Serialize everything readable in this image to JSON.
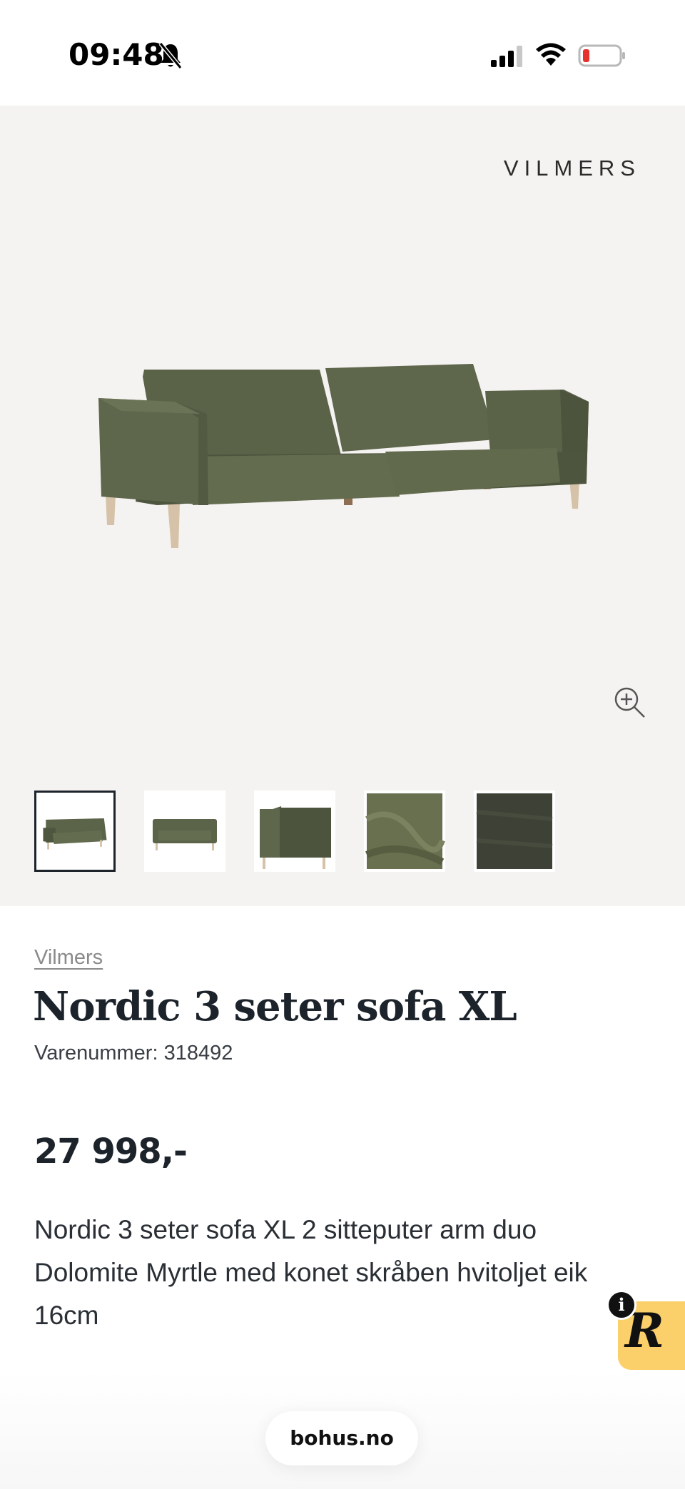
{
  "status_bar": {
    "time": "09:48",
    "icons": [
      "bell-slash-icon",
      "signal-icon",
      "wifi-icon",
      "battery-low-icon"
    ],
    "battery_color": "#e5322d"
  },
  "gallery": {
    "brand_logo": "VILMERS",
    "main_image": "sofa-image",
    "zoom_icon": "zoom-in-icon",
    "thumbnails": [
      {
        "name": "thumb-sofa-front",
        "selected": true
      },
      {
        "name": "thumb-sofa-straight",
        "selected": false
      },
      {
        "name": "thumb-sofa-side",
        "selected": false
      },
      {
        "name": "thumb-fabric-green",
        "selected": false
      },
      {
        "name": "thumb-fabric-dark",
        "selected": false
      }
    ]
  },
  "product": {
    "brand_link": "Vilmers",
    "title": "Nordic 3 seter sofa XL",
    "sku": "Varenummer: 318492",
    "price": "27 998,-",
    "description": "Nordic 3 seter sofa XL 2 sitteputer arm duo Dolomite Myrtle med konet skråben hvitoljet eik 16cm"
  },
  "widget": {
    "letter": "R",
    "info": "i",
    "color": "#fbcf6a"
  },
  "browser": {
    "url": "bohus.no"
  },
  "colors": {
    "hero_bg": "#f5f3f1",
    "sofa": "#5c6449",
    "text": "#1c232b"
  }
}
